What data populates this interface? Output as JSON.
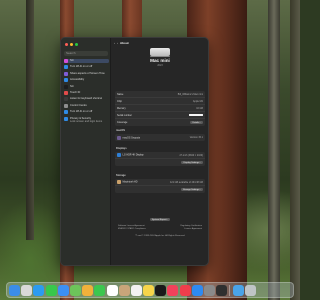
{
  "window": {
    "nav_title": "About",
    "search_placeholder": "Search"
  },
  "sidebar": {
    "items": [
      {
        "label": "Siri",
        "sub": "",
        "color": "#d14fd8",
        "selected": true
      },
      {
        "label": "Turn Wi-Fi on or off",
        "sub": "",
        "color": "#2f8ae5"
      },
      {
        "label": "Share aspects of Screen Time",
        "sub": "",
        "color": "#7f5dd6"
      },
      {
        "label": "Accessibility",
        "sub": "",
        "color": "#2f8ae5"
      },
      {
        "label": "Siri",
        "sub": "",
        "color": "#1e1e1e"
      },
      {
        "label": "Touch ID",
        "sub": "",
        "color": "#e14b4b"
      },
      {
        "label": "Listen for keyboard shortcut",
        "sub": "",
        "color": "#3a3a3a"
      },
      {
        "label": "Control Centre",
        "sub": "",
        "color": "#8e8e8e"
      },
      {
        "label": "Turn Wi-Fi on or off",
        "sub": "",
        "color": "#2f8ae5"
      },
      {
        "label": "Privacy & Security",
        "sub": "Lock screen and login items",
        "color": "#2f8ae5"
      }
    ]
  },
  "hero": {
    "name": "Mac mini",
    "subtitle": "2023"
  },
  "info_rows": [
    {
      "label": "Name",
      "value": "Bill_Williams's Mac mini"
    },
    {
      "label": "Chip",
      "value": "Apple M2"
    },
    {
      "label": "Memory",
      "value": "16 GB"
    },
    {
      "label": "Serial number",
      "value": ""
    },
    {
      "label": "Coverage",
      "value": "Details..."
    }
  ],
  "macos": {
    "title": "macOS",
    "name": "macOS Sequoia",
    "version": "Version 15.1"
  },
  "displays": {
    "title": "Displays",
    "name": "LG HDR 4K Display",
    "detail": "27-inch (3840 × 2160)",
    "button": "Display Settings..."
  },
  "storage": {
    "title": "Storage",
    "name": "Macintosh HD",
    "detail": "421 GB available of 494.38 GB",
    "button": "Storage Settings..."
  },
  "report_button": "System Report...",
  "footer_links": [
    "Software Licence Agreement",
    "Regulatory Certification",
    "ENERGY STAR® Compliance",
    "Licence Agreement"
  ],
  "footer_copyright": "™ and © 1983-2024 Apple Inc. All Rights Reserved.",
  "dock": {
    "apps": [
      {
        "name": "finder-icon",
        "color": "#3b8de8"
      },
      {
        "name": "launchpad-icon",
        "color": "#d9d9d9"
      },
      {
        "name": "safari-icon",
        "color": "#2c9bf0"
      },
      {
        "name": "messages-icon",
        "color": "#38c84b"
      },
      {
        "name": "mail-icon",
        "color": "#3d8ff5"
      },
      {
        "name": "maps-icon",
        "color": "#6dc45a"
      },
      {
        "name": "photos-icon",
        "color": "#f0b13b"
      },
      {
        "name": "facetime-icon",
        "color": "#3cc74f"
      },
      {
        "name": "calendar-icon",
        "color": "#ffffff"
      },
      {
        "name": "contacts-icon",
        "color": "#c9a57a"
      },
      {
        "name": "reminders-icon",
        "color": "#f2f2f2"
      },
      {
        "name": "notes-icon",
        "color": "#f6d54a"
      },
      {
        "name": "tv-icon",
        "color": "#1a1a1a"
      },
      {
        "name": "music-icon",
        "color": "#f1415b"
      },
      {
        "name": "news-icon",
        "color": "#f03e4c"
      },
      {
        "name": "app-store-icon",
        "color": "#2e8af2"
      },
      {
        "name": "system-settings-icon",
        "color": "#8a8a8a"
      },
      {
        "name": "iphone-mirroring-icon",
        "color": "#2f2f2f"
      }
    ],
    "after_separator": [
      {
        "name": "downloads-folder-icon",
        "color": "#4aa3e8"
      },
      {
        "name": "trash-icon",
        "color": "#bfc4c6"
      }
    ]
  }
}
